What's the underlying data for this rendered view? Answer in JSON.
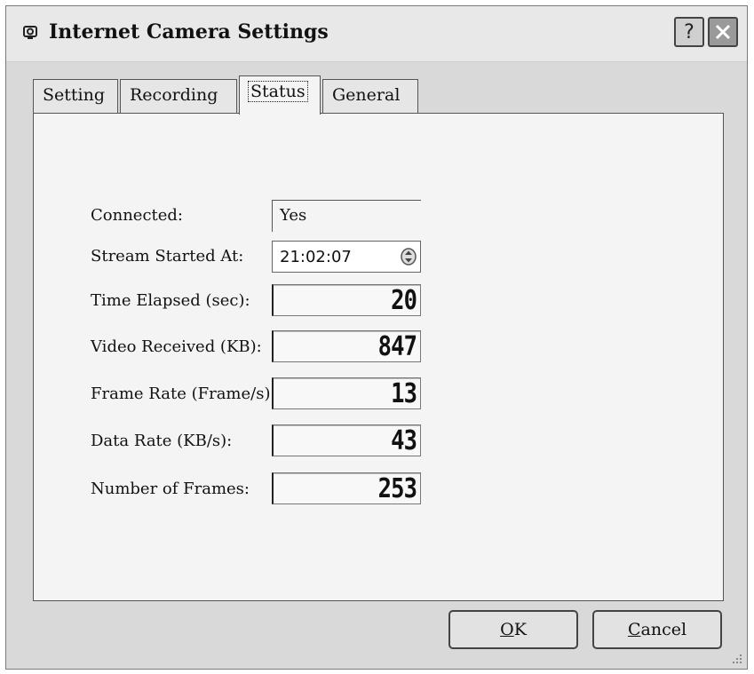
{
  "window": {
    "title": "Internet Camera Settings",
    "help_glyph": "?"
  },
  "tabs": [
    {
      "label": "Setting"
    },
    {
      "label": "Recording"
    },
    {
      "label": "Status"
    },
    {
      "label": "General"
    }
  ],
  "status": {
    "connected": {
      "label": "Connected:",
      "value": "Yes"
    },
    "stream_started": {
      "label": "Stream Started At:",
      "value": "21:02:07"
    },
    "time_elapsed": {
      "label": "Time Elapsed (sec):",
      "value": "20"
    },
    "video_received": {
      "label": "Video Received (KB):",
      "value": "847"
    },
    "frame_rate": {
      "label": "Frame Rate (Frame/s):",
      "value": "13"
    },
    "data_rate": {
      "label": "Data Rate (KB/s):",
      "value": "43"
    },
    "frames": {
      "label": "Number of Frames:",
      "value": "253"
    }
  },
  "buttons": {
    "ok": {
      "mnemonic": "O",
      "rest": "K"
    },
    "cancel": {
      "mnemonic": "C",
      "rest": "ancel"
    }
  }
}
